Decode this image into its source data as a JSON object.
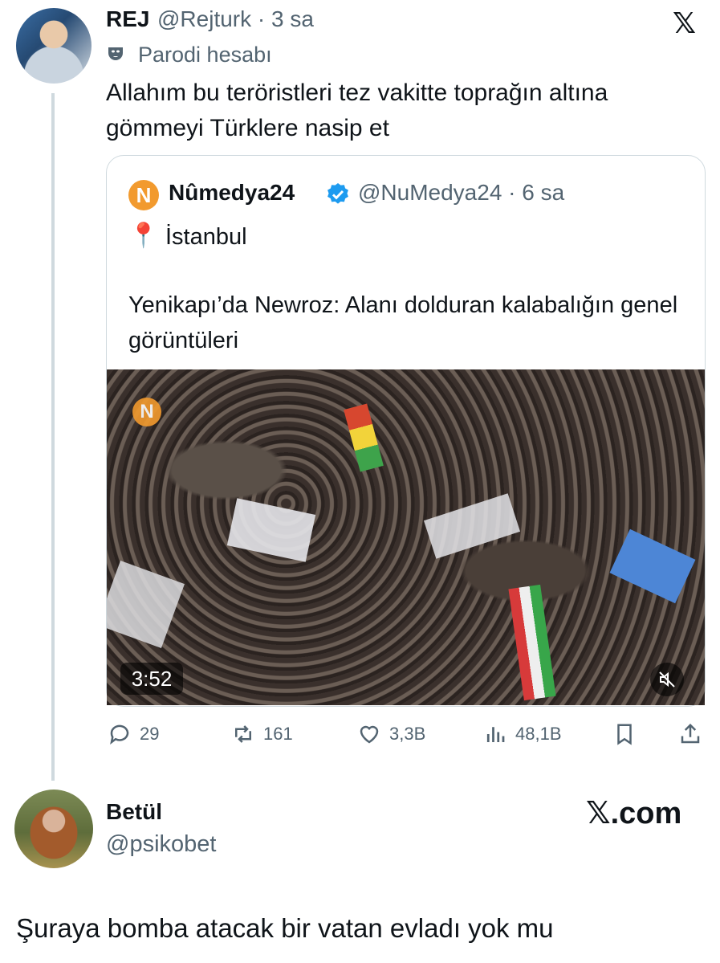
{
  "tweet": {
    "author_name": "REJ",
    "author_handle_time": "@Rejturk · 3 sa",
    "parody_label": "Parodi hesabı",
    "text": "Allahım bu teröristleri tez vakitte toprağın altına gömmeyi Türklere nasip et",
    "platform_icon": "x-logo"
  },
  "quote": {
    "author_name": "Nûmedya24",
    "verified": true,
    "author_handle_time": "@NuMedya24 · 6 sa",
    "location_icon": "📍",
    "location": "İstanbul",
    "text": "Yenikapı’da Newroz: Alanı dolduran kalabalığın genel görüntüleri",
    "video_duration": "3:52",
    "logo_letter": "N"
  },
  "actions": {
    "replies": "29",
    "reposts": "161",
    "likes": "3,3B",
    "views": "48,1B"
  },
  "reply": {
    "author_name": "Betül",
    "author_handle": "@psikobet",
    "site": "𝕏.com",
    "text": "Şuraya bomba atacak bir vatan evladı yok mu"
  },
  "colors": {
    "accent": "#1d9bf0",
    "muted": "#536471",
    "border": "#cfd9de",
    "brand_orange": "#f29a2e"
  }
}
